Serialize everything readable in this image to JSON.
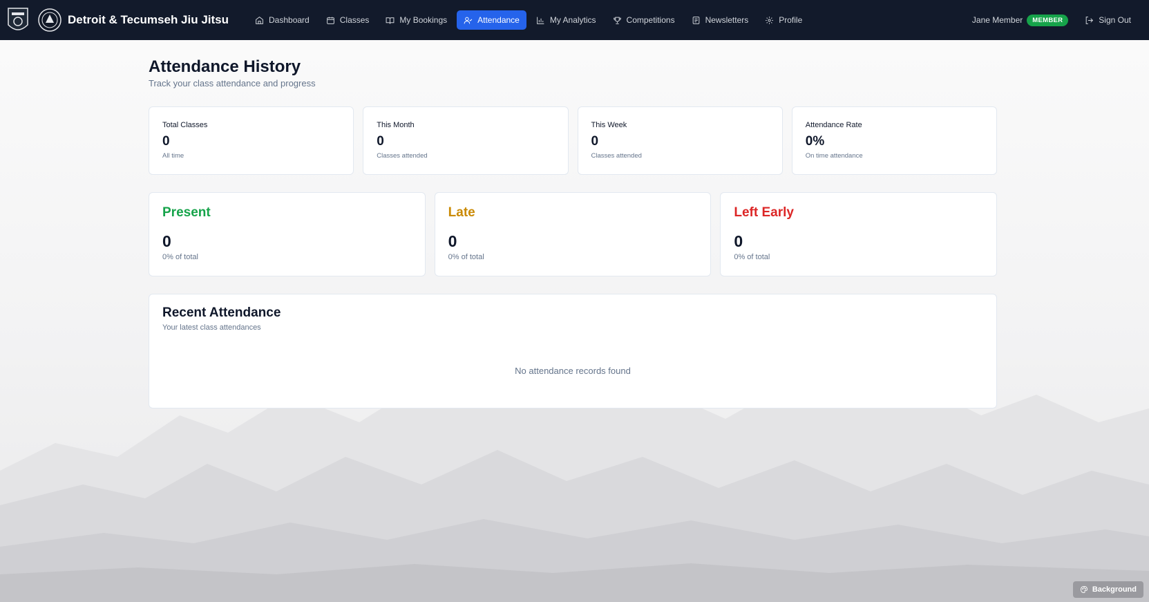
{
  "header": {
    "brand": "Detroit & Tecumseh Jiu Jitsu",
    "nav": [
      {
        "label": "Dashboard",
        "icon": "home-icon"
      },
      {
        "label": "Classes",
        "icon": "calendar-icon"
      },
      {
        "label": "My Bookings",
        "icon": "book-icon"
      },
      {
        "label": "Attendance",
        "icon": "user-check-icon",
        "active": true
      },
      {
        "label": "My Analytics",
        "icon": "bar-chart-icon"
      },
      {
        "label": "Competitions",
        "icon": "trophy-icon"
      },
      {
        "label": "Newsletters",
        "icon": "newspaper-icon"
      },
      {
        "label": "Profile",
        "icon": "gear-icon"
      }
    ],
    "user_name": "Jane Member",
    "role_badge": "MEMBER",
    "sign_out": "Sign Out"
  },
  "page": {
    "title": "Attendance History",
    "subtitle": "Track your class attendance and progress"
  },
  "stats": [
    {
      "label": "Total Classes",
      "value": "0",
      "sub": "All time"
    },
    {
      "label": "This Month",
      "value": "0",
      "sub": "Classes attended"
    },
    {
      "label": "This Week",
      "value": "0",
      "sub": "Classes attended"
    },
    {
      "label": "Attendance Rate",
      "value": "0%",
      "sub": "On time attendance"
    }
  ],
  "status": [
    {
      "title": "Present",
      "value": "0",
      "sub": "0% of total",
      "color": "#16a34a"
    },
    {
      "title": "Late",
      "value": "0",
      "sub": "0% of total",
      "color": "#ca8a04"
    },
    {
      "title": "Left Early",
      "value": "0",
      "sub": "0% of total",
      "color": "#dc2626"
    }
  ],
  "recent": {
    "title": "Recent Attendance",
    "subtitle": "Your latest class attendances",
    "empty_message": "No attendance records found"
  },
  "background_button": "Background",
  "colors": {
    "nav_bg": "#121a2b",
    "accent": "#2563eb",
    "badge": "#16a34a"
  }
}
